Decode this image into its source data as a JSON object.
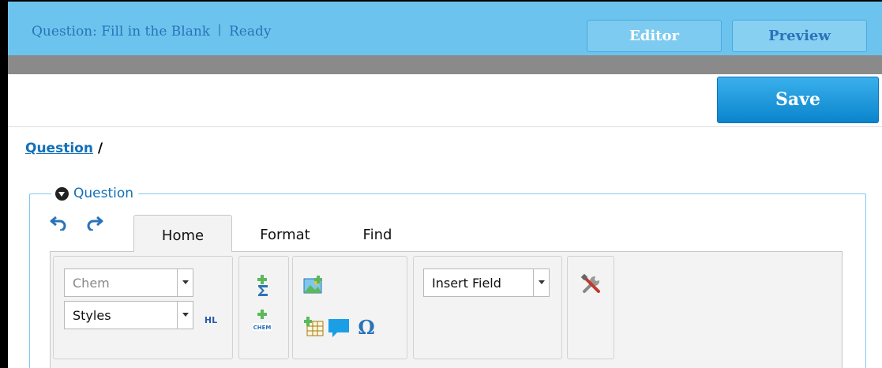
{
  "header": {
    "title": "Question: Fill in the Blank",
    "separator": "|",
    "status": "Ready",
    "editor_label": "Editor",
    "preview_label": "Preview"
  },
  "toolbar": {
    "save_label": "Save"
  },
  "breadcrumb": {
    "link": "Question",
    "separator": "/"
  },
  "question_panel": {
    "legend": "Question",
    "tabs": [
      {
        "label": "Home",
        "active": true
      },
      {
        "label": "Format",
        "active": false
      },
      {
        "label": "Find",
        "active": false
      }
    ],
    "ribbon": {
      "chem_select": "Chem",
      "styles_select": "Styles",
      "hl_label": "HL",
      "insert_field_select": "Insert Field",
      "omega_label": "Ω",
      "icons": [
        "undo-icon",
        "redo-icon",
        "sigma-icon",
        "chem-icon",
        "image-icon",
        "table-icon",
        "comment-icon",
        "omega-icon",
        "tools-icon"
      ]
    }
  },
  "colors": {
    "header_bg": "#6cc4ee",
    "accent_blue": "#1370b8",
    "save_button": "#0a84cc",
    "grey_bar": "#8a8a8a",
    "ribbon_bg": "#f3f3f3"
  }
}
